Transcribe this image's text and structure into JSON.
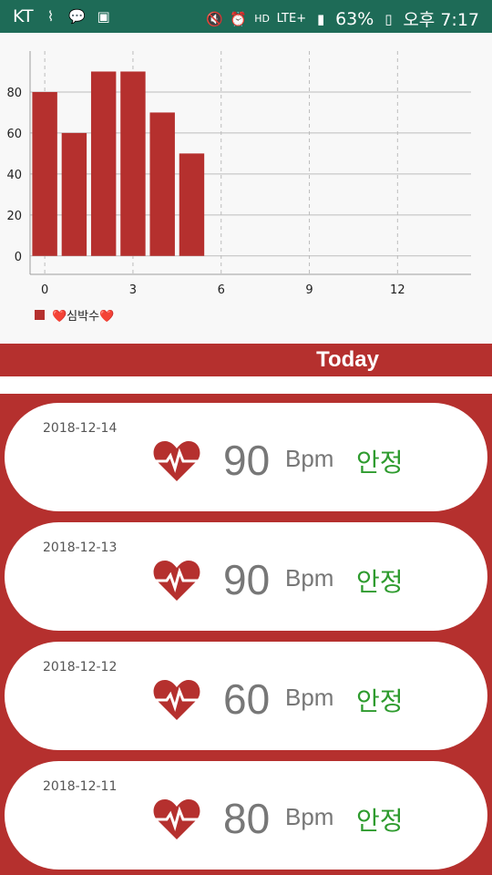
{
  "status_bar": {
    "carrier": "KT",
    "battery": "63%",
    "time": "오후 7:17",
    "network": "LTE+",
    "icons": [
      "clip-icon",
      "talk-icon",
      "image-icon",
      "mute-icon",
      "alarm-icon",
      "hd-icon",
      "signal-icon",
      "battery-icon"
    ]
  },
  "chart_data": {
    "type": "bar",
    "categories": [
      0,
      1,
      2,
      3,
      4,
      5
    ],
    "values": [
      80,
      60,
      90,
      90,
      70,
      50
    ],
    "xlim": [
      -0.5,
      14.5
    ],
    "ylim": [
      -9,
      100
    ],
    "xticks": [
      0,
      3,
      6,
      9,
      12
    ],
    "yticks": [
      0,
      20,
      40,
      60,
      80
    ],
    "legend": "❤️심박수❤️",
    "legend_position": "bottom-left",
    "grid": true,
    "bar_color": "#b5302e"
  },
  "header": {
    "title": "Today"
  },
  "records": [
    {
      "date": "2018-12-14",
      "bpm": "90",
      "unit": "Bpm",
      "status": "안정"
    },
    {
      "date": "2018-12-13",
      "bpm": "90",
      "unit": "Bpm",
      "status": "안정"
    },
    {
      "date": "2018-12-12",
      "bpm": "60",
      "unit": "Bpm",
      "status": "안정"
    },
    {
      "date": "2018-12-11",
      "bpm": "80",
      "unit": "Bpm",
      "status": "안정"
    }
  ],
  "colors": {
    "status_bar": "#1e6b57",
    "accent": "#b5302e",
    "status_ok": "#2e9b2e"
  }
}
